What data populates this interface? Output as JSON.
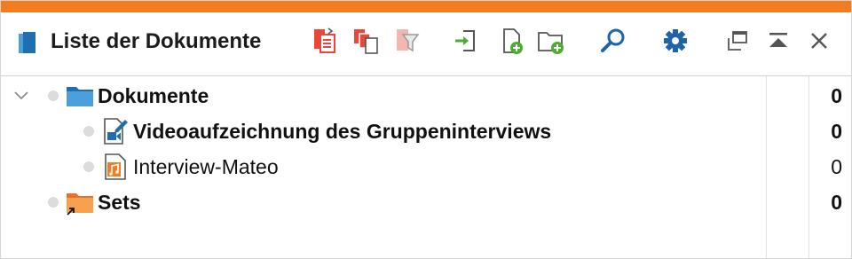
{
  "window": {
    "title": "Liste der Dokumente",
    "accent_color": "#f47b20"
  },
  "toolbar": {
    "buttons": [
      {
        "name": "restore-documents-icon"
      },
      {
        "name": "copy-documents-icon"
      },
      {
        "name": "filter-documents-icon"
      },
      {
        "name": "import-icon"
      },
      {
        "name": "new-document-icon"
      },
      {
        "name": "new-folder-icon"
      },
      {
        "name": "search-icon"
      },
      {
        "name": "settings-icon"
      }
    ],
    "window_controls": [
      {
        "name": "undock-window-icon"
      },
      {
        "name": "collapse-up-icon"
      },
      {
        "name": "close-icon"
      }
    ]
  },
  "tree": {
    "rows": [
      {
        "label": "Dokumente",
        "count": "0",
        "bold": true,
        "icon": "folder-icon"
      },
      {
        "label": "Videoaufzeichnung des Gruppeninterviews",
        "count": "0",
        "bold": true,
        "icon": "video-document-icon"
      },
      {
        "label": "Interview-Mateo",
        "count": "0",
        "bold": false,
        "icon": "audio-document-icon"
      },
      {
        "label": "Sets",
        "count": "0",
        "bold": true,
        "icon": "sets-folder-icon"
      }
    ]
  }
}
